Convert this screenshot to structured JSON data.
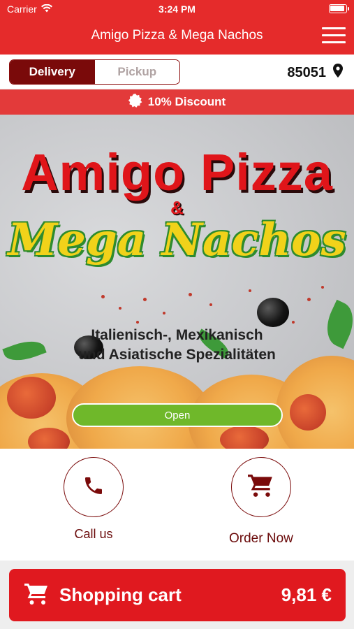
{
  "status_bar": {
    "carrier": "Carrier",
    "time": "3:24 PM"
  },
  "nav": {
    "title": "Amigo Pizza & Mega Nachos",
    "menu_icon": "hamburger-menu-icon"
  },
  "mode": {
    "delivery_label": "Delivery",
    "pickup_label": "Pickup",
    "selected": "Delivery",
    "zip": "85051",
    "location_icon": "map-pin-icon"
  },
  "discount": {
    "label": "10% Discount",
    "icon": "badge-icon"
  },
  "hero": {
    "title_line1": "Amigo Pizza",
    "ampersand": "&",
    "title_line2": "Mega Nachos",
    "subtitle_line1": "Italienisch-, Mexikanisch",
    "subtitle_line2": "und Asiatische Spezialitäten",
    "status_button": "Open"
  },
  "actions": {
    "call_label": "Call us",
    "call_icon": "phone-icon",
    "order_label": "Order Now",
    "order_icon": "cart-icon"
  },
  "cart": {
    "label": "Shopping cart",
    "total": "9,81 €",
    "icon": "cart-icon"
  },
  "colors": {
    "primary_red": "#e52b2b",
    "dark_red": "#7a0a0a",
    "open_green": "#6fb82a",
    "title_yellow": "#f1d21a"
  }
}
